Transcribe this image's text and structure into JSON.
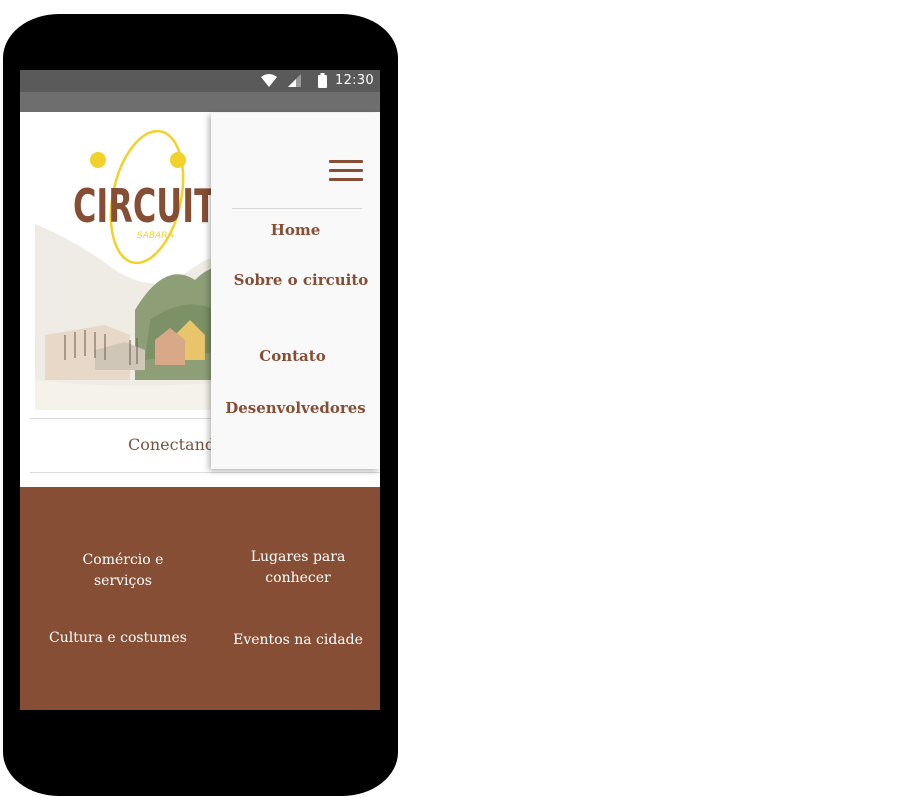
{
  "status_bar": {
    "time": "12:30"
  },
  "logo": {
    "title": "CIRCUITO",
    "subtitle": "SABARÁ"
  },
  "tagline": "Conectando",
  "menu": {
    "items": [
      {
        "label": "Home"
      },
      {
        "label": "Sobre o circuito"
      },
      {
        "label": "Contato"
      },
      {
        "label": "Desenvolvedores"
      }
    ]
  },
  "categories": [
    {
      "label": "Comércio e serviços"
    },
    {
      "label": "Lugares para conhecer"
    },
    {
      "label": "Cultura e costumes"
    },
    {
      "label": "Eventos na cidade"
    }
  ],
  "colors": {
    "brand_brown": "#864f35",
    "logo_yellow": "#f2d22a"
  }
}
